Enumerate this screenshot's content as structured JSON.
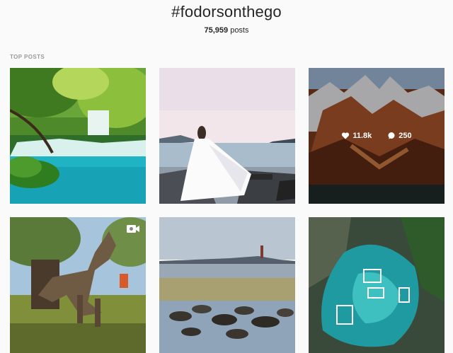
{
  "header": {
    "hashtag": "#fodorsonthego",
    "post_count": "75,959",
    "post_suffix": " posts"
  },
  "top_posts": {
    "label": "TOP POSTS",
    "items": [
      {
        "subject": "waterfall-lagoon"
      },
      {
        "subject": "woman-white-dress-sea"
      },
      {
        "subject": "mountain-peaks",
        "likes": "11.8k",
        "comments": "250"
      },
      {
        "subject": "driftwood-horse-sculpture",
        "icon": "video-camera-icon"
      },
      {
        "subject": "lighthouse-seals"
      },
      {
        "subject": "lagoon-boats-aerial"
      }
    ]
  }
}
